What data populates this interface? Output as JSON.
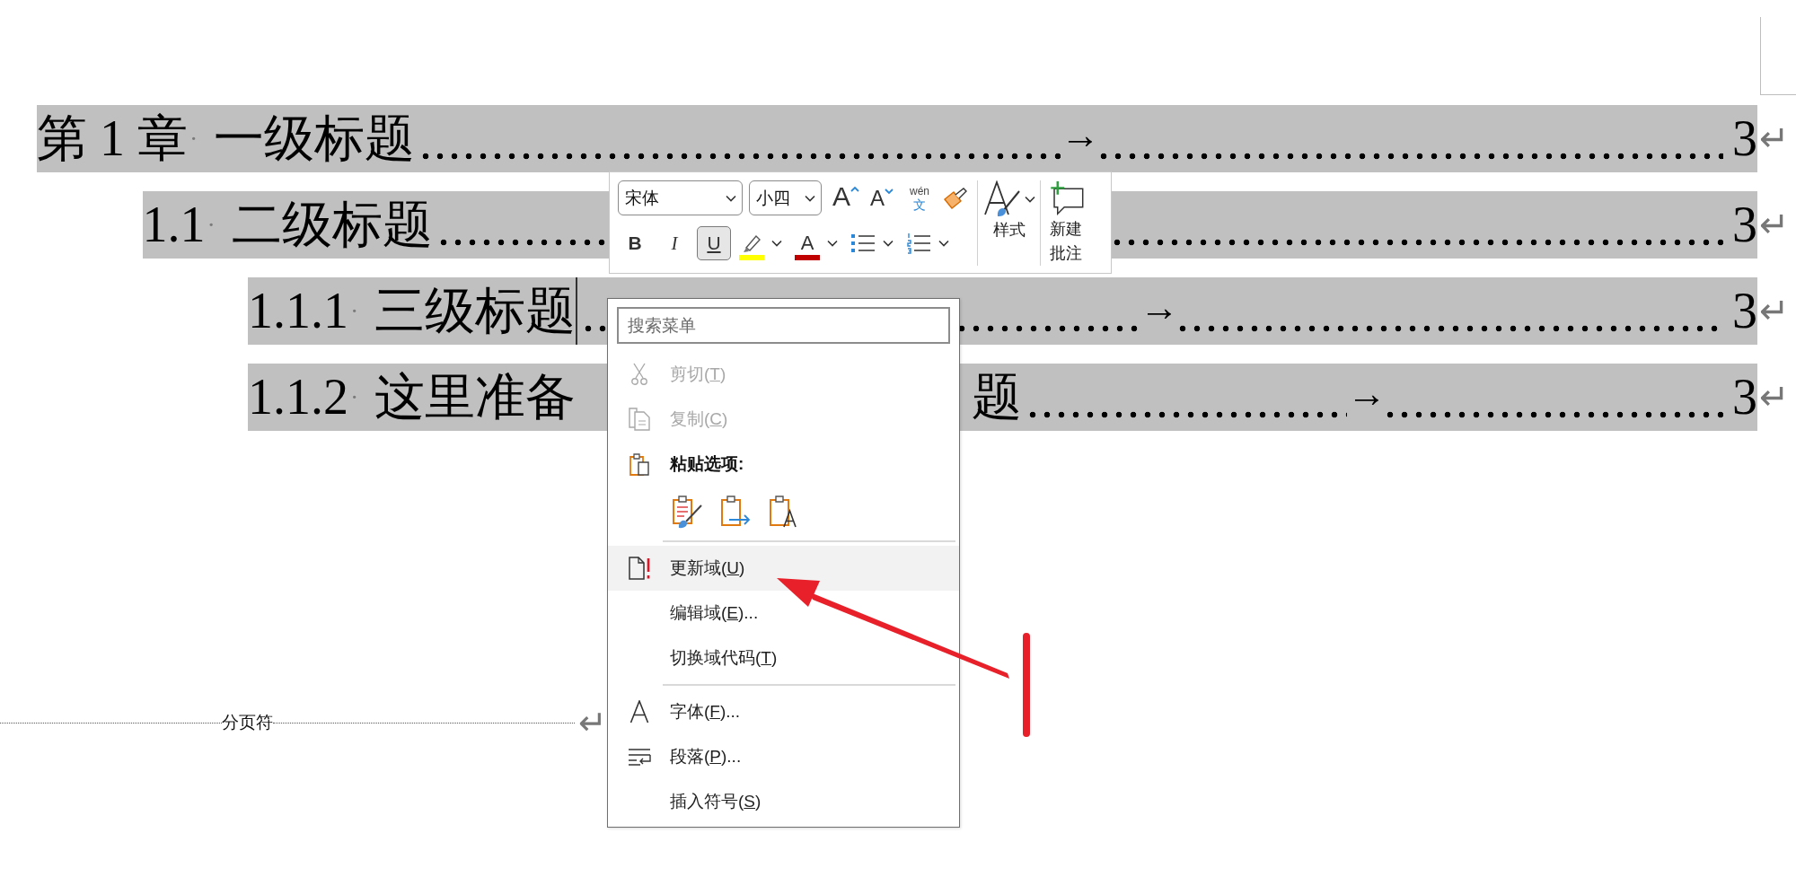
{
  "toc": [
    {
      "number": "第 1 章",
      "space_mark": "·",
      "title": "一级标题",
      "tab_mark": "→",
      "page": "3",
      "paragraph_mark": "↵",
      "caret": false,
      "children": [
        {
          "number": "1.1",
          "space_mark": "·",
          "title": "二级标题",
          "page": "3",
          "paragraph_mark": "↵",
          "caret": false,
          "children": [
            {
              "number": "1.1.1",
              "space_mark": "·",
              "title": "三级标题",
              "tab_mark": "→",
              "page": "3",
              "paragraph_mark": "↵",
              "caret": true
            },
            {
              "number": "1.1.2",
              "space_mark": "·",
              "title": "这里准备",
              "title_end": "题",
              "tab_mark": "→",
              "page": "3",
              "paragraph_mark": "↵",
              "caret": false
            }
          ]
        }
      ]
    }
  ],
  "page_break": {
    "label": "分页符",
    "paragraph_mark": "↵"
  },
  "mini_toolbar": {
    "font": "宋体",
    "size": "小四",
    "grow_font": "A",
    "shrink_font": "A",
    "phonetic_guide": {
      "pinyin": "wén",
      "character": "文"
    },
    "format_buttons": [
      {
        "kind": "bold",
        "label": "B",
        "selected": false
      },
      {
        "kind": "italic",
        "label": "I",
        "selected": false
      },
      {
        "kind": "underline",
        "label": "U",
        "selected": true
      }
    ],
    "font_color_label": "A",
    "styles_label": "样式",
    "comment_label": "新建批注"
  },
  "context_menu": {
    "search_placeholder": "搜索菜单",
    "items": [
      {
        "kind": "command",
        "before": "剪切(",
        "key": "T",
        "after": ")",
        "disabled": true,
        "selected": false
      },
      {
        "kind": "command",
        "before": "复制(",
        "key": "C",
        "after": ")",
        "disabled": true,
        "selected": false
      },
      {
        "kind": "header",
        "text": "粘贴选项:"
      },
      {
        "kind": "paste_options"
      },
      {
        "kind": "separator"
      },
      {
        "kind": "command",
        "before": "更新域(",
        "key": "U",
        "after": ")",
        "disabled": false,
        "selected": true
      },
      {
        "kind": "command",
        "before": "编辑域(",
        "key": "E",
        "after": ")...",
        "disabled": false,
        "selected": false
      },
      {
        "kind": "command",
        "before": "切换域代码(",
        "key": "T",
        "after": ")",
        "disabled": false,
        "selected": false
      },
      {
        "kind": "separator"
      },
      {
        "kind": "command",
        "before": "字体(",
        "key": "F",
        "after": ")...",
        "disabled": false,
        "selected": false
      },
      {
        "kind": "command",
        "before": "段落(",
        "key": "P",
        "after": ")...",
        "disabled": false,
        "selected": false
      },
      {
        "kind": "command",
        "before": "插入符号(",
        "key": "S",
        "after": ")",
        "disabled": false,
        "selected": false
      }
    ]
  }
}
